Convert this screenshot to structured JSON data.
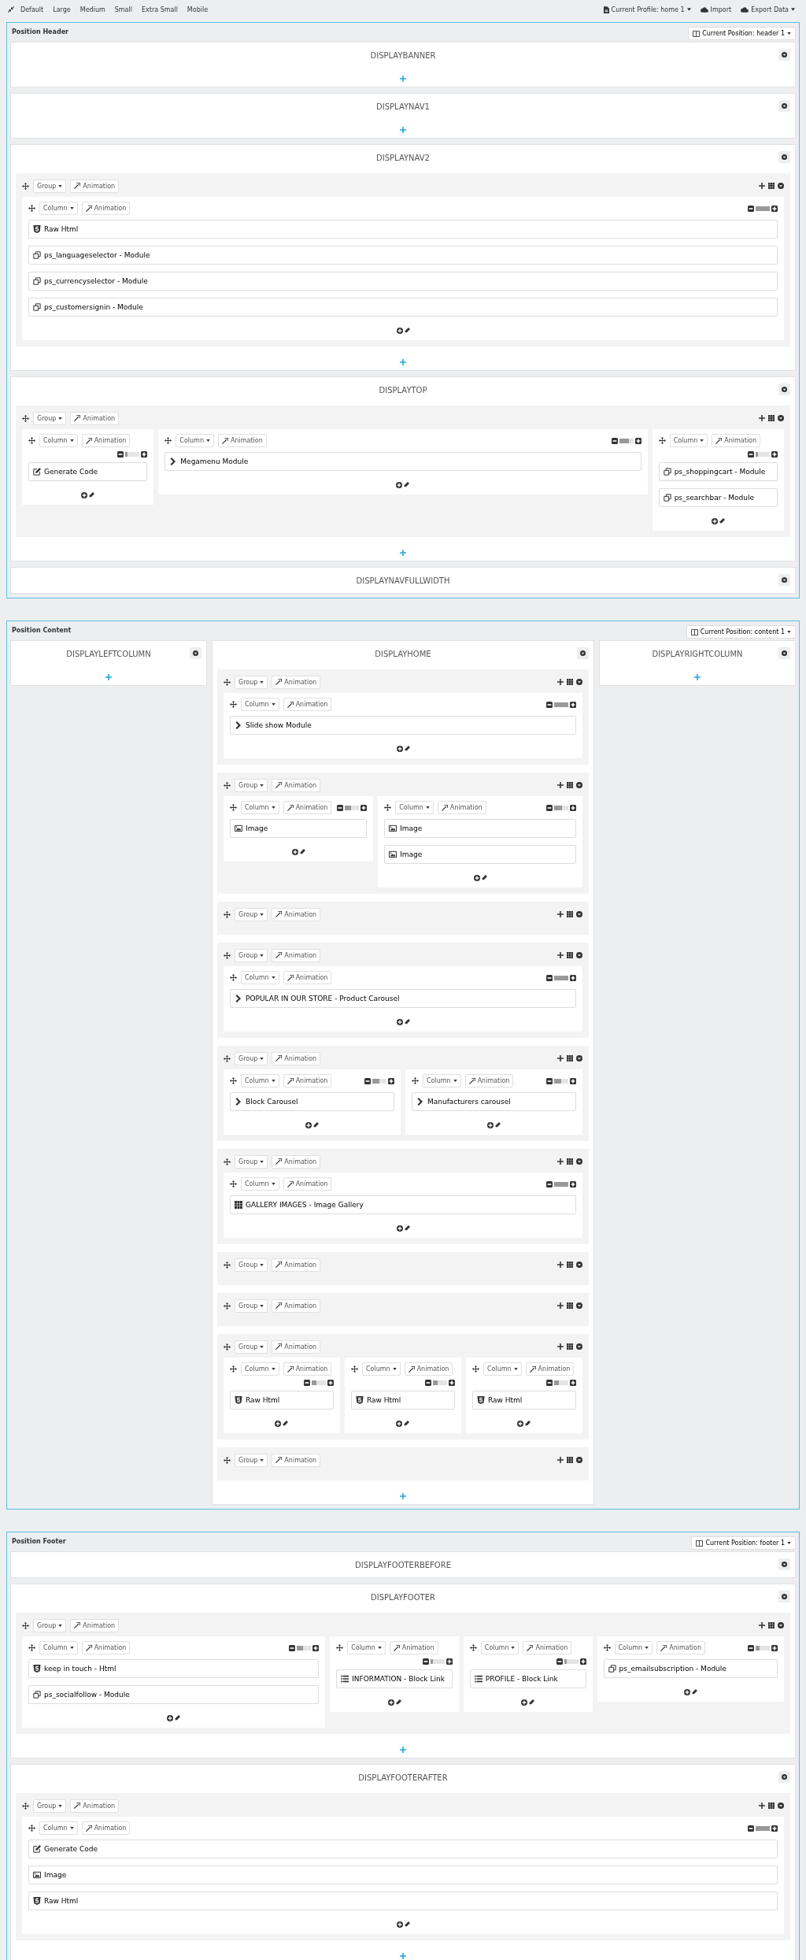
{
  "toolbar": {
    "sizes": [
      "Default",
      "Large",
      "Medium",
      "Small",
      "Extra Small",
      "Mobile"
    ],
    "profile": "Current Profile: home 1",
    "import": "Import",
    "export": "Export Data"
  },
  "positions": [
    {
      "title": "Position Header",
      "selector": "Current Position: header 1",
      "kind": "stack",
      "hooks": [
        {
          "name": "DISPLAYBANNER",
          "add_button": true
        },
        {
          "name": "DISPLAYNAV1",
          "add_button": true
        },
        {
          "name": "DISPLAYNAV2",
          "add_button": true,
          "groups": [
            {
              "buttons": [
                "Group",
                "Animation"
              ],
              "columns": [
                {
                  "buttons": [
                    "Column",
                    "Animation"
                  ],
                  "level": 1,
                  "widgets": [
                    {
                      "kind": "html",
                      "label": "Raw Html"
                    },
                    {
                      "kind": "module",
                      "label": "ps_languageselector - Module"
                    },
                    {
                      "kind": "module",
                      "label": "ps_currencyselector - Module"
                    },
                    {
                      "kind": "module",
                      "label": "ps_customersignin - Module"
                    }
                  ]
                }
              ]
            }
          ]
        },
        {
          "name": "DISPLAYTOP",
          "add_button": true,
          "groups": [
            {
              "buttons": [
                "Group",
                "Animation"
              ],
              "columns": [
                {
                  "buttons": [
                    "Column",
                    "Animation"
                  ],
                  "level": 0.1667,
                  "widgets": [
                    {
                      "kind": "code",
                      "label": "Generate Code"
                    }
                  ]
                },
                {
                  "buttons": [
                    "Column",
                    "Animation"
                  ],
                  "level": 0.6667,
                  "widgets": [
                    {
                      "kind": "chevron",
                      "label": "Megamenu Module"
                    }
                  ]
                },
                {
                  "buttons": [
                    "Column",
                    "Animation"
                  ],
                  "level": 0.1667,
                  "widgets": [
                    {
                      "kind": "module",
                      "label": "ps_shoppingcart - Module"
                    },
                    {
                      "kind": "module",
                      "label": "ps_searchbar - Module"
                    }
                  ]
                }
              ]
            }
          ]
        },
        {
          "name": "DISPLAYNAVFULLWIDTH",
          "add_button": false
        }
      ]
    },
    {
      "title": "Position Content",
      "selector": "Current Position: content 1",
      "kind": "columns",
      "hooks": [
        {
          "name": "DISPLAYLEFTCOLUMN",
          "add_button": true
        },
        {
          "name": "DISPLAYHOME",
          "add_button": true,
          "groups": [
            {
              "buttons": [
                "Group",
                "Animation"
              ],
              "columns": [
                {
                  "buttons": [
                    "Column",
                    "Animation"
                  ],
                  "level": 1,
                  "widgets": [
                    {
                      "kind": "chevron",
                      "label": "Slide show Module"
                    }
                  ]
                }
              ]
            },
            {
              "buttons": [
                "Group",
                "Animation"
              ],
              "columns": [
                {
                  "buttons": [
                    "Column",
                    "Animation"
                  ],
                  "level": 0.4167,
                  "widgets": [
                    {
                      "kind": "image",
                      "label": "Image"
                    }
                  ]
                },
                {
                  "buttons": [
                    "Column",
                    "Animation"
                  ],
                  "level": 0.5833,
                  "widgets": [
                    {
                      "kind": "image",
                      "label": "Image"
                    },
                    {
                      "kind": "image",
                      "label": "Image"
                    }
                  ]
                }
              ]
            },
            {
              "buttons": [
                "Group",
                "Animation"
              ]
            },
            {
              "buttons": [
                "Group",
                "Animation"
              ],
              "columns": [
                {
                  "buttons": [
                    "Column",
                    "Animation"
                  ],
                  "level": 1,
                  "widgets": [
                    {
                      "kind": "chevron",
                      "label": "POPULAR IN OUR STORE - Product Carousel"
                    }
                  ]
                }
              ]
            },
            {
              "buttons": [
                "Group",
                "Animation"
              ],
              "columns": [
                {
                  "buttons": [
                    "Column",
                    "Animation"
                  ],
                  "level": 0.5,
                  "widgets": [
                    {
                      "kind": "chevron",
                      "label": "Block Carousel"
                    }
                  ]
                },
                {
                  "buttons": [
                    "Column",
                    "Animation"
                  ],
                  "level": 0.5,
                  "widgets": [
                    {
                      "kind": "chevron",
                      "label": "Manufacturers carousel"
                    }
                  ]
                }
              ]
            },
            {
              "buttons": [
                "Group",
                "Animation"
              ],
              "columns": [
                {
                  "buttons": [
                    "Column",
                    "Animation"
                  ],
                  "level": 1,
                  "widgets": [
                    {
                      "kind": "gallery",
                      "label": "GALLERY IMAGES - Image Gallery"
                    }
                  ]
                }
              ]
            },
            {
              "buttons": [
                "Group",
                "Animation"
              ]
            },
            {
              "buttons": [
                "Group",
                "Animation"
              ]
            },
            {
              "buttons": [
                "Group",
                "Animation"
              ],
              "columns": [
                {
                  "buttons": [
                    "Column",
                    "Animation"
                  ],
                  "level": 0.3333,
                  "widgets": [
                    {
                      "kind": "html",
                      "label": "Raw Html"
                    }
                  ]
                },
                {
                  "buttons": [
                    "Column",
                    "Animation"
                  ],
                  "level": 0.3333,
                  "widgets": [
                    {
                      "kind": "html",
                      "label": "Raw Html"
                    }
                  ]
                },
                {
                  "buttons": [
                    "Column",
                    "Animation"
                  ],
                  "level": 0.3333,
                  "widgets": [
                    {
                      "kind": "html",
                      "label": "Raw Html"
                    }
                  ]
                }
              ]
            },
            {
              "buttons": [
                "Group",
                "Animation"
              ]
            }
          ]
        },
        {
          "name": "DISPLAYRIGHTCOLUMN",
          "add_button": true
        }
      ]
    },
    {
      "title": "Position Footer",
      "selector": "Current Position: footer 1",
      "kind": "stack",
      "hooks": [
        {
          "name": "DISPLAYFOOTERBEFORE",
          "add_button": false
        },
        {
          "name": "DISPLAYFOOTER",
          "add_button": true,
          "groups": [
            {
              "buttons": [
                "Group",
                "Animation"
              ],
              "columns": [
                {
                  "buttons": [
                    "Column",
                    "Animation"
                  ],
                  "level": 0.4167,
                  "widgets": [
                    {
                      "kind": "html",
                      "label": "keep in touch - Html"
                    },
                    {
                      "kind": "module",
                      "label": "ps_socialfollow - Module"
                    }
                  ]
                },
                {
                  "buttons": [
                    "Column",
                    "Animation"
                  ],
                  "level": 0.1667,
                  "widgets": [
                    {
                      "kind": "list",
                      "label": "INFORMATION - Block Link"
                    }
                  ]
                },
                {
                  "buttons": [
                    "Column",
                    "Animation"
                  ],
                  "level": 0.1667,
                  "widgets": [
                    {
                      "kind": "list",
                      "label": "PROFILE - Block Link"
                    }
                  ]
                },
                {
                  "buttons": [
                    "Column",
                    "Animation"
                  ],
                  "level": 0.25,
                  "widgets": [
                    {
                      "kind": "module",
                      "label": "ps_emailsubscription - Module"
                    }
                  ]
                }
              ]
            }
          ]
        },
        {
          "name": "DISPLAYFOOTERAFTER",
          "add_button": true,
          "groups": [
            {
              "buttons": [
                "Group",
                "Animation"
              ],
              "columns": [
                {
                  "buttons": [
                    "Column",
                    "Animation"
                  ],
                  "level": 1,
                  "widgets": [
                    {
                      "kind": "code",
                      "label": "Generate Code"
                    },
                    {
                      "kind": "image",
                      "label": "Image"
                    },
                    {
                      "kind": "html",
                      "label": "Raw Html"
                    }
                  ]
                }
              ]
            }
          ]
        }
      ]
    }
  ]
}
